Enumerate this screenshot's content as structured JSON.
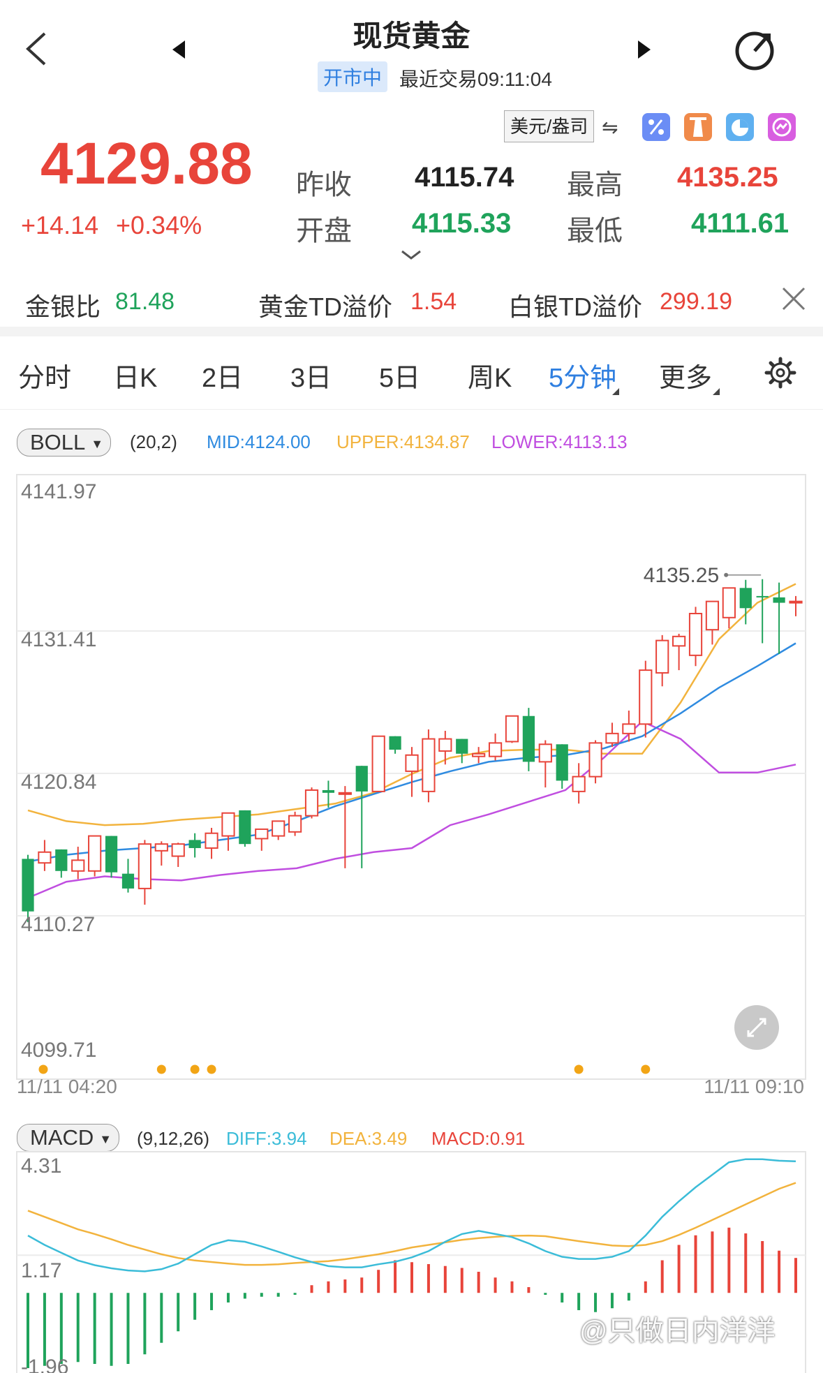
{
  "header": {
    "title": "现货黄金",
    "status_badge": "开市中",
    "last_trade": "最近交易09:11:04"
  },
  "quote": {
    "price": "4129.88",
    "change": "+14.14",
    "change_pct": "+0.34%",
    "unit": "美元/盎司",
    "prev_close_label": "昨收",
    "prev_close": "4115.74",
    "open_label": "开盘",
    "open": "4115.33",
    "high_label": "最高",
    "high": "4135.25",
    "low_label": "最低",
    "low": "4111.61"
  },
  "ratios": [
    {
      "label": "金银比",
      "value": "81.48"
    },
    {
      "label": "黄金TD溢价",
      "value": "1.54"
    },
    {
      "label": "白银TD溢价",
      "value": "299.19"
    }
  ],
  "tabs": [
    "分时",
    "日K",
    "2日",
    "3日",
    "5日",
    "周K",
    "5分钟",
    "更多"
  ],
  "active_tab": "5分钟",
  "boll": {
    "chip": "BOLL",
    "params": "(20,2)",
    "mid": "MID:4124.00",
    "upper": "UPPER:4134.87",
    "lower": "LOWER:4113.13"
  },
  "macd": {
    "chip": "MACD",
    "params": "(9,12,26)",
    "diff": "DIFF:3.94",
    "dea": "DEA:3.49",
    "macd": "MACD:0.91"
  },
  "price_axis": [
    "4141.97",
    "4131.41",
    "4120.84",
    "4110.27",
    "4099.71"
  ],
  "time_axis": [
    "11/11 04:20",
    "11/11 09:10"
  ],
  "max_marker": "4135.25",
  "macd_axis": [
    "4.31",
    "1.17",
    "-1.96"
  ],
  "watermark": "@只做日内洋洋",
  "colors": {
    "up": "#e8443a",
    "down": "#1fa35b",
    "mid": "#2f8be0",
    "upper": "#f2b33d",
    "lower": "#c04ee0",
    "diff": "#3bbcd8",
    "dea": "#f2b33d",
    "accent": "#2f7fe0"
  },
  "chart_data": [
    {
      "type": "candlestick",
      "title": "",
      "ylim": [
        4099.71,
        4141.97
      ],
      "x_range": [
        "11/11 04:20",
        "11/11 09:10"
      ],
      "candles_ohlc": [
        [
          4114.5,
          4114.8,
          4109.8,
          4110.6
        ],
        [
          4114.2,
          4115.9,
          4113.6,
          4115.0
        ],
        [
          4115.2,
          4115.2,
          4113.1,
          4113.6
        ],
        [
          4113.6,
          4115.4,
          4113.0,
          4114.4
        ],
        [
          4113.6,
          4116.1,
          4113.2,
          4116.2
        ],
        [
          4116.2,
          4116.2,
          4113.1,
          4113.5
        ],
        [
          4113.4,
          4114.5,
          4112.0,
          4112.3
        ],
        [
          4112.3,
          4115.9,
          4111.1,
          4115.6
        ],
        [
          4115.1,
          4115.8,
          4114.0,
          4115.6
        ],
        [
          4114.7,
          4115.7,
          4113.9,
          4115.6
        ],
        [
          4115.9,
          4116.4,
          4114.6,
          4115.3
        ],
        [
          4115.3,
          4116.8,
          4114.5,
          4116.4
        ],
        [
          4116.2,
          4117.9,
          4115.1,
          4117.9
        ],
        [
          4118.1,
          4118.1,
          4115.4,
          4115.6
        ],
        [
          4116.0,
          4116.7,
          4115.1,
          4116.7
        ],
        [
          4116.2,
          4117.3,
          4115.9,
          4117.3
        ],
        [
          4116.5,
          4118.0,
          4116.2,
          4117.7
        ],
        [
          4117.7,
          4119.8,
          4117.5,
          4119.6
        ],
        [
          4119.6,
          4120.3,
          4118.3,
          4119.4
        ],
        [
          4119.4,
          4119.9,
          4113.8,
          4119.4
        ],
        [
          4121.4,
          4121.4,
          4113.8,
          4119.5
        ],
        [
          4119.5,
          4123.5,
          4119.5,
          4123.6
        ],
        [
          4123.6,
          4123.6,
          4122.3,
          4122.6
        ],
        [
          4121.0,
          4122.8,
          4119.1,
          4122.2
        ],
        [
          4119.5,
          4124.1,
          4118.7,
          4123.4
        ],
        [
          4122.5,
          4124.0,
          4121.5,
          4123.4
        ],
        [
          4123.4,
          4123.4,
          4121.6,
          4122.3
        ],
        [
          4122.1,
          4122.8,
          4121.6,
          4122.3
        ],
        [
          4122.1,
          4123.8,
          4121.8,
          4123.1
        ],
        [
          4123.2,
          4125.1,
          4123.1,
          4125.1
        ],
        [
          4125.1,
          4125.7,
          4121.0,
          4121.7
        ],
        [
          4121.7,
          4123.3,
          4119.8,
          4123.0
        ],
        [
          4123.0,
          4123.0,
          4119.7,
          4120.3
        ],
        [
          4119.5,
          4121.6,
          4118.6,
          4120.6
        ],
        [
          4120.6,
          4123.3,
          4120.1,
          4123.1
        ],
        [
          4123.1,
          4124.6,
          4122.8,
          4123.8
        ],
        [
          4123.8,
          4125.5,
          4123.2,
          4124.5
        ],
        [
          4124.5,
          4129.2,
          4123.5,
          4128.5
        ],
        [
          4128.3,
          4131.1,
          4127.3,
          4130.7
        ],
        [
          4130.3,
          4131.2,
          4128.5,
          4131.0
        ],
        [
          4129.6,
          4133.2,
          4128.8,
          4132.7
        ],
        [
          4131.5,
          4133.6,
          4130.4,
          4133.6
        ],
        [
          4132.4,
          4134.6,
          4131.6,
          4134.6
        ],
        [
          4134.6,
          4135.2,
          4131.9,
          4133.1
        ],
        [
          4134.0,
          4135.25,
          4130.5,
          4133.9
        ],
        [
          4133.9,
          4135.0,
          4129.7,
          4133.5
        ],
        [
          4133.6,
          4134.0,
          4132.5,
          4133.6
        ]
      ],
      "boll_upper": [
        4118.1,
        4117.3,
        4117.0,
        4117.1,
        4117.4,
        4117.6,
        4117.8,
        4118.2,
        4118.6,
        4119.4,
        4120.8,
        4122.0,
        4122.5,
        4122.6,
        4122.6,
        4122.3,
        4122.3,
        4126.1,
        4130.8,
        4133.5,
        4134.9
      ],
      "boll_mid": [
        4114.3,
        4114.8,
        4115.1,
        4115.3,
        4115.5,
        4115.9,
        4116.3,
        4117.3,
        4118.4,
        4119.3,
        4120.2,
        4121.0,
        4121.7,
        4122.0,
        4122.2,
        4122.7,
        4123.6,
        4125.3,
        4127.2,
        4128.8,
        4130.5
      ],
      "boll_lower": [
        4111.6,
        4112.8,
        4113.2,
        4113.0,
        4112.9,
        4113.3,
        4113.6,
        4113.8,
        4114.5,
        4115.0,
        4115.3,
        4117.0,
        4117.8,
        4118.7,
        4119.6,
        4122.0,
        4124.7,
        4123.4,
        4120.9,
        4120.9,
        4121.5
      ]
    },
    {
      "type": "bar",
      "title": "",
      "ylim": [
        -1.96,
        4.31
      ],
      "diff": [
        1.8,
        1.5,
        1.25,
        1.0,
        0.85,
        0.75,
        0.68,
        0.65,
        0.72,
        0.9,
        1.2,
        1.5,
        1.65,
        1.6,
        1.45,
        1.28,
        1.1,
        0.95,
        0.82,
        0.78,
        0.78,
        0.88,
        0.96,
        1.1,
        1.3,
        1.6,
        1.85,
        1.95,
        1.85,
        1.75,
        1.55,
        1.3,
        1.12,
        1.05,
        1.05,
        1.12,
        1.3,
        1.8,
        2.4,
        2.9,
        3.35,
        3.75,
        4.15,
        4.25,
        4.25,
        4.2,
        4.18
      ],
      "dea": [
        2.6,
        2.4,
        2.2,
        2.0,
        1.85,
        1.68,
        1.5,
        1.35,
        1.2,
        1.08,
        1.0,
        0.95,
        0.9,
        0.86,
        0.86,
        0.88,
        0.92,
        0.95,
        0.98,
        1.04,
        1.12,
        1.2,
        1.3,
        1.42,
        1.5,
        1.58,
        1.66,
        1.72,
        1.76,
        1.79,
        1.8,
        1.78,
        1.7,
        1.62,
        1.55,
        1.48,
        1.46,
        1.5,
        1.62,
        1.82,
        2.05,
        2.3,
        2.55,
        2.8,
        3.05,
        3.3,
        3.49
      ],
      "macd": [
        -1.96,
        -1.9,
        -1.85,
        -1.8,
        -1.85,
        -1.9,
        -1.85,
        -1.6,
        -1.3,
        -1.0,
        -0.7,
        -0.45,
        -0.25,
        -0.15,
        -0.1,
        -0.1,
        -0.05,
        0.2,
        0.3,
        0.35,
        0.4,
        0.6,
        0.85,
        0.8,
        0.75,
        0.7,
        0.65,
        0.55,
        0.4,
        0.3,
        0.15,
        -0.05,
        -0.25,
        -0.45,
        -0.5,
        -0.4,
        -0.2,
        0.3,
        0.85,
        1.25,
        1.5,
        1.6,
        1.7,
        1.55,
        1.35,
        1.1,
        0.91
      ]
    }
  ]
}
